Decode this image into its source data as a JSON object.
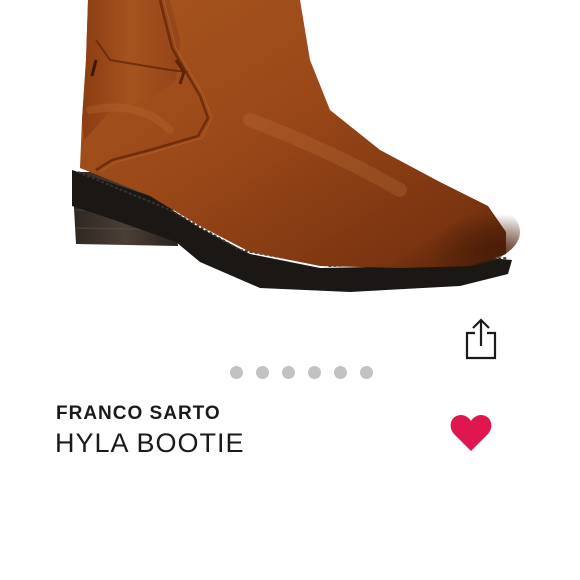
{
  "product": {
    "brand": "FRANCO SARTO",
    "name": "HYLA BOOTIE"
  },
  "carousel": {
    "dot_count": 6
  },
  "icons": {
    "share": "share-icon",
    "favorite": "heart-icon"
  },
  "colors": {
    "heart": "#e0174f",
    "dot": "#c2c2c2",
    "text": "#1a1a1a",
    "boot_leather": "#9c4a1c"
  }
}
